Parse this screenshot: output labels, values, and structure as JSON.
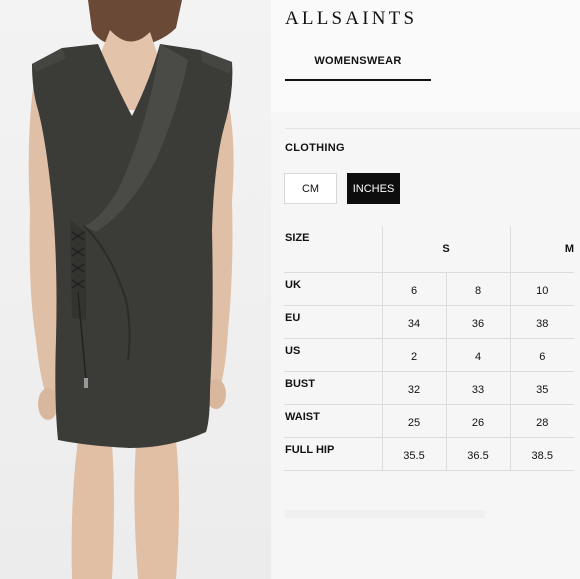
{
  "brand": "ALLSAINTS",
  "tab": {
    "label": "WOMENSWEAR"
  },
  "section": {
    "title": "CLOTHING"
  },
  "units": {
    "cm": "CM",
    "inches": "INCHES",
    "selected": "INCHES"
  },
  "table": {
    "size_label": "SIZE",
    "size_groups": [
      {
        "label": "S",
        "columns": 2
      },
      {
        "label": "M",
        "columns": 1
      }
    ],
    "rows": [
      {
        "label": "UK",
        "values": [
          "6",
          "8",
          "10"
        ]
      },
      {
        "label": "EU",
        "values": [
          "34",
          "36",
          "38"
        ]
      },
      {
        "label": "US",
        "values": [
          "2",
          "4",
          "6"
        ]
      },
      {
        "label": "BUST",
        "values": [
          "32",
          "33",
          "35"
        ]
      },
      {
        "label": "WAIST",
        "values": [
          "25",
          "26",
          "28"
        ]
      },
      {
        "label": "FULL HIP",
        "values": [
          "35.5",
          "36.5",
          "38.5"
        ]
      }
    ]
  },
  "colors": {
    "dress": "#3b3b38",
    "selected_bg": "#0d0d0d"
  }
}
